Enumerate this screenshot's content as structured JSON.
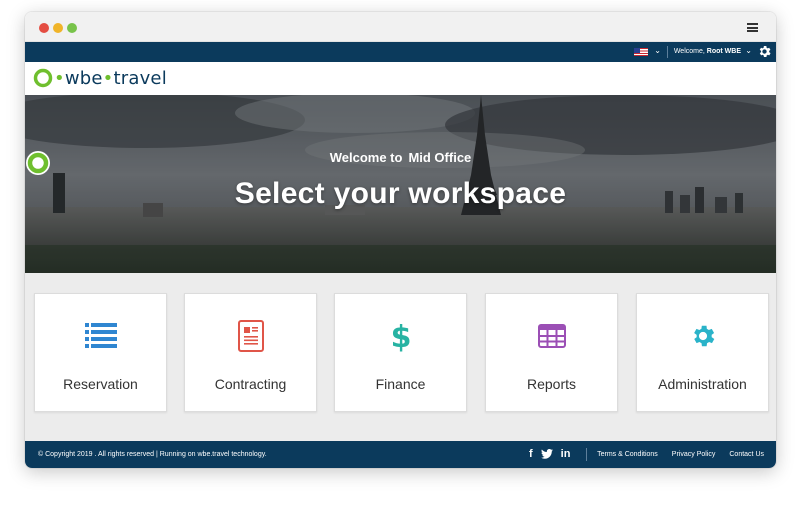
{
  "topbar": {
    "welcome_prefix": "Welcome,",
    "user_name": "Root WBE",
    "language": "us-flag"
  },
  "logo": {
    "prefix": "•",
    "brand": "wbe",
    "separator": "•",
    "suffix": "travel"
  },
  "hero": {
    "welcome_text": "Welcome to",
    "product_name": "Mid Office",
    "title": "Select your workspace"
  },
  "tiles": [
    {
      "label": "Reservation",
      "icon": "list-icon",
      "color": "#2f86d1"
    },
    {
      "label": "Contracting",
      "icon": "document-icon",
      "color": "#e05548"
    },
    {
      "label": "Finance",
      "icon": "dollar-icon",
      "color": "#27b3a3"
    },
    {
      "label": "Reports",
      "icon": "table-icon",
      "color": "#9b4fb5"
    },
    {
      "label": "Administration",
      "icon": "gear-icon",
      "color": "#2ab3c9"
    }
  ],
  "footer": {
    "copyright": "© Copyright 2019 . All rights reserved  |  Running on wbe.travel technology.",
    "social": [
      "f",
      "t",
      "in"
    ],
    "links": [
      "Terms & Conditions",
      "Privacy Policy",
      "Contact Us"
    ]
  },
  "colors": {
    "navy": "#0b3a5c",
    "brand_green": "#6fbf2e"
  }
}
